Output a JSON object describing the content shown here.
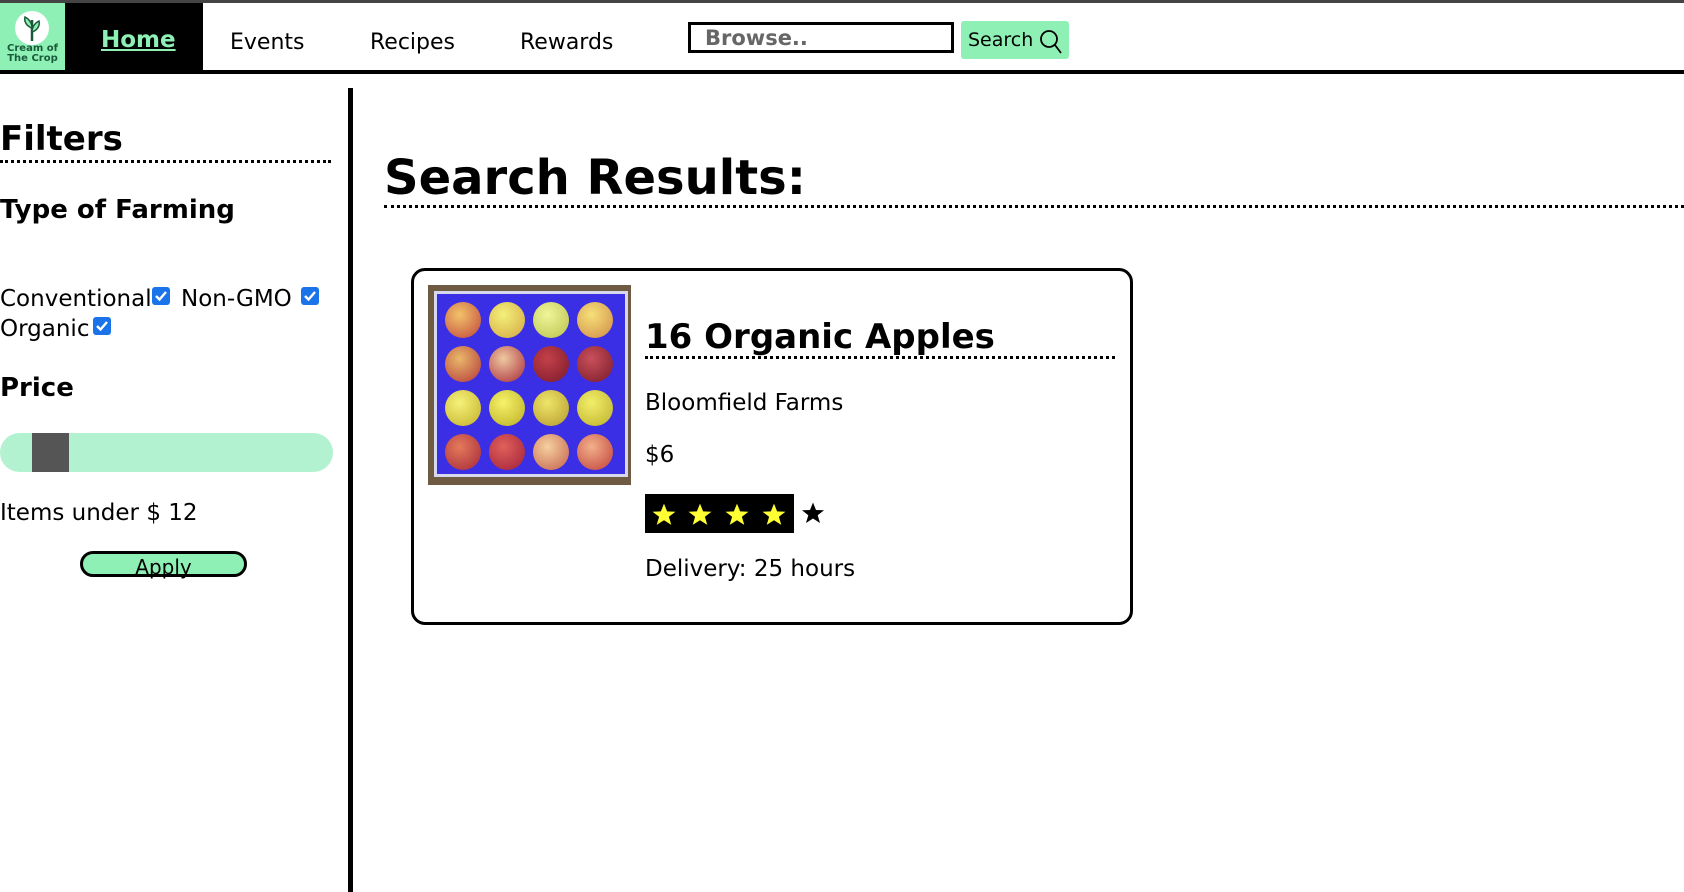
{
  "brand": {
    "logo_text_line1": "Cream of",
    "logo_text_line2": "The Crop"
  },
  "nav": {
    "home": "Home",
    "events": "Events",
    "recipes": "Recipes",
    "rewards": "Rewards"
  },
  "search": {
    "placeholder": "Browse..",
    "button_label": "Search"
  },
  "filters": {
    "title": "Filters",
    "type_title": "Type of Farming",
    "options": [
      {
        "label": "Conventional",
        "checked": true
      },
      {
        "label": "Non-GMO",
        "checked": true
      },
      {
        "label": "Organic",
        "checked": true
      }
    ],
    "price_title": "Price",
    "price_max": 12,
    "under_text": "Items under $ 12",
    "apply_label": "Apply"
  },
  "results": {
    "title": "Search Results:",
    "items": [
      {
        "name": "16 Organic Apples",
        "farm": "Bloomfield Farms",
        "price": "$6",
        "rating": 4,
        "rating_max": 5,
        "delivery": "Delivery: 25 hours"
      }
    ]
  },
  "colors": {
    "accent": "#8ef0b4",
    "slider_track": "#b3f2d0",
    "checkbox": "#1a73e8",
    "star": "#ffff33"
  }
}
